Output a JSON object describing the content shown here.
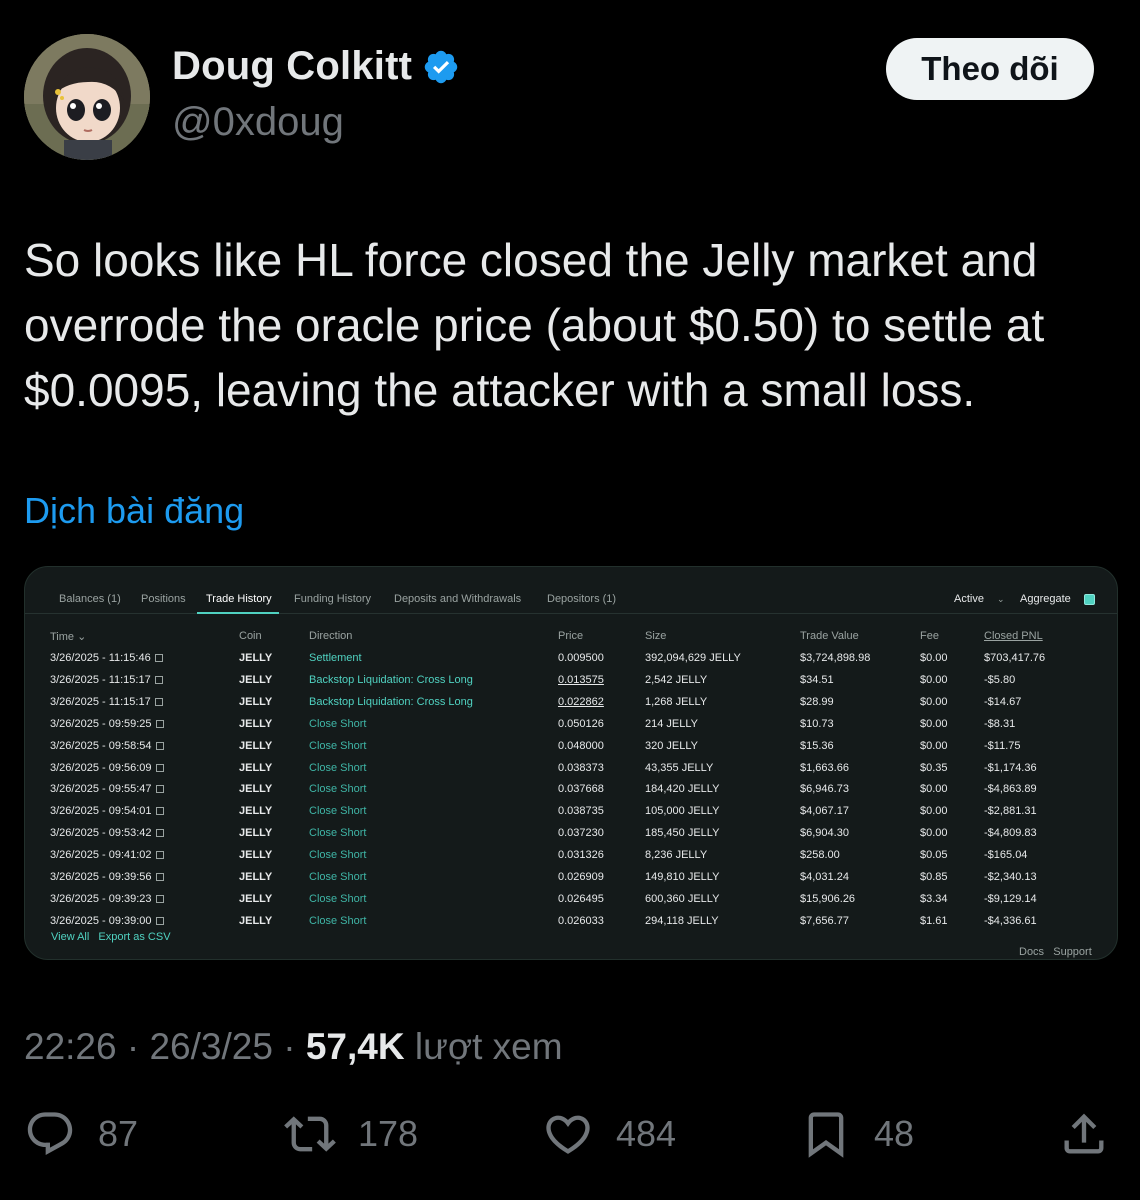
{
  "author": {
    "display_name": "Doug Colkitt",
    "handle": "@0xdoug",
    "verified_icon": "verified-badge-icon"
  },
  "follow_label": "Theo dõi",
  "tweet_text": "So looks like HL force closed the Jelly market and overrode the oracle price (about $0.50) to settle at $0.0095, leaving the attacker with a small loss.",
  "translate_label": "Dịch bài đăng",
  "screenshot": {
    "tabs": [
      "Balances (1)",
      "Positions",
      "Trade History",
      "Funding History",
      "Deposits and Withdrawals",
      "Depositors (1)"
    ],
    "active_tab": "Trade History",
    "filter": "Active",
    "aggregate_label": "Aggregate",
    "columns": [
      "Time",
      "Coin",
      "Direction",
      "Price",
      "Size",
      "Trade Value",
      "Fee",
      "Closed PNL"
    ],
    "rows": [
      {
        "time": "3/26/2025 - 11:15:46",
        "coin": "JELLY",
        "direction": "Settlement",
        "price": "0.009500",
        "size": "392,094,629 JELLY",
        "value": "$3,724,898.98",
        "fee": "$0.00",
        "pnl": "$703,417.76"
      },
      {
        "time": "3/26/2025 - 11:15:17",
        "coin": "JELLY",
        "direction": "Backstop Liquidation: Cross Long",
        "price": "0.013575",
        "size": "2,542 JELLY",
        "value": "$34.51",
        "fee": "$0.00",
        "pnl": "-$5.80"
      },
      {
        "time": "3/26/2025 - 11:15:17",
        "coin": "JELLY",
        "direction": "Backstop Liquidation: Cross Long",
        "price": "0.022862",
        "size": "1,268 JELLY",
        "value": "$28.99",
        "fee": "$0.00",
        "pnl": "-$14.67"
      },
      {
        "time": "3/26/2025 - 09:59:25",
        "coin": "JELLY",
        "direction": "Close Short",
        "price": "0.050126",
        "size": "214 JELLY",
        "value": "$10.73",
        "fee": "$0.00",
        "pnl": "-$8.31"
      },
      {
        "time": "3/26/2025 - 09:58:54",
        "coin": "JELLY",
        "direction": "Close Short",
        "price": "0.048000",
        "size": "320 JELLY",
        "value": "$15.36",
        "fee": "$0.00",
        "pnl": "-$11.75"
      },
      {
        "time": "3/26/2025 - 09:56:09",
        "coin": "JELLY",
        "direction": "Close Short",
        "price": "0.038373",
        "size": "43,355 JELLY",
        "value": "$1,663.66",
        "fee": "$0.35",
        "pnl": "-$1,174.36"
      },
      {
        "time": "3/26/2025 - 09:55:47",
        "coin": "JELLY",
        "direction": "Close Short",
        "price": "0.037668",
        "size": "184,420 JELLY",
        "value": "$6,946.73",
        "fee": "$0.00",
        "pnl": "-$4,863.89"
      },
      {
        "time": "3/26/2025 - 09:54:01",
        "coin": "JELLY",
        "direction": "Close Short",
        "price": "0.038735",
        "size": "105,000 JELLY",
        "value": "$4,067.17",
        "fee": "$0.00",
        "pnl": "-$2,881.31"
      },
      {
        "time": "3/26/2025 - 09:53:42",
        "coin": "JELLY",
        "direction": "Close Short",
        "price": "0.037230",
        "size": "185,450 JELLY",
        "value": "$6,904.30",
        "fee": "$0.00",
        "pnl": "-$4,809.83"
      },
      {
        "time": "3/26/2025 - 09:41:02",
        "coin": "JELLY",
        "direction": "Close Short",
        "price": "0.031326",
        "size": "8,236 JELLY",
        "value": "$258.00",
        "fee": "$0.05",
        "pnl": "-$165.04"
      },
      {
        "time": "3/26/2025 - 09:39:56",
        "coin": "JELLY",
        "direction": "Close Short",
        "price": "0.026909",
        "size": "149,810 JELLY",
        "value": "$4,031.24",
        "fee": "$0.85",
        "pnl": "-$2,340.13"
      },
      {
        "time": "3/26/2025 - 09:39:23",
        "coin": "JELLY",
        "direction": "Close Short",
        "price": "0.026495",
        "size": "600,360 JELLY",
        "value": "$15,906.26",
        "fee": "$3.34",
        "pnl": "-$9,129.14"
      },
      {
        "time": "3/26/2025 - 09:39:00",
        "coin": "JELLY",
        "direction": "Close Short",
        "price": "0.026033",
        "size": "294,118 JELLY",
        "value": "$7,656.77",
        "fee": "$1.61",
        "pnl": "-$4,336.61"
      }
    ],
    "view_all": "View All",
    "export_csv": "Export as CSV",
    "docs": "Docs",
    "support": "Support"
  },
  "meta": {
    "time": "22:26",
    "date": "26/3/25",
    "views_count": "57,4K",
    "views_label": "lượt xem"
  },
  "actions": {
    "replies": "87",
    "reposts": "178",
    "likes": "484",
    "bookmarks": "48"
  }
}
